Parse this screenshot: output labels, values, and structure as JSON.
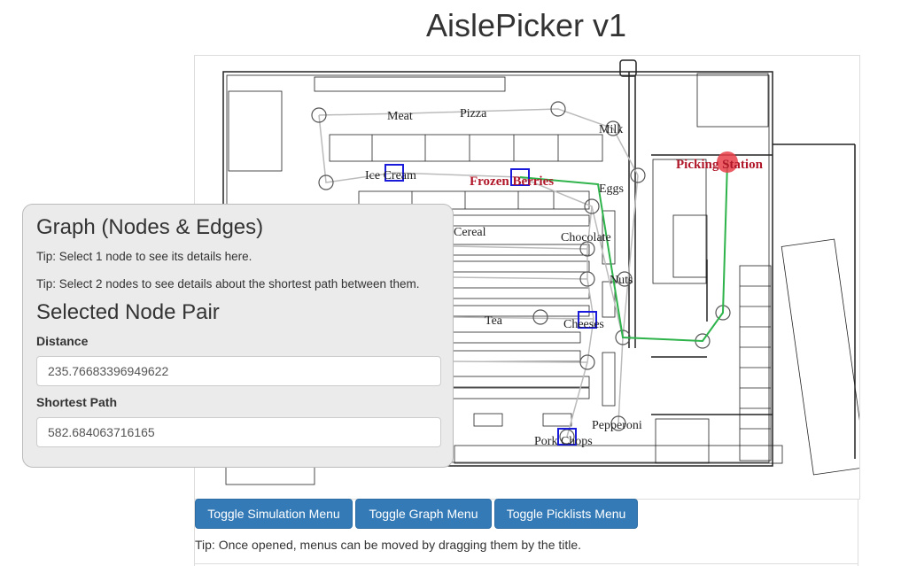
{
  "app": {
    "title": "AislePicker v1"
  },
  "map": {
    "labels": {
      "meat": "Meat",
      "pizza": "Pizza",
      "milk": "Milk",
      "ice_cream": "Ice Cream",
      "frozen_berries": "Frozen Berries",
      "picking_station": "Picking Station",
      "eggs": "Eggs",
      "cereal": "Cereal",
      "chocolate": "Chocolate",
      "nuts": "Nuts",
      "tea": "Tea",
      "cheeses": "Cheeses",
      "pepperoni": "Pepperoni",
      "pork_chops": "Pork Chops"
    },
    "colors": {
      "path": "#2db34a",
      "station": "#e8404a",
      "selected": "#1a1adb",
      "edge": "#bbbbbb"
    }
  },
  "panel": {
    "heading": "Graph (Nodes & Edges)",
    "tip1": "Tip: Select 1 node to see its details here.",
    "tip2": "Tip: Select 2 nodes to see details about the shortest path between them.",
    "pair_heading": "Selected Node Pair",
    "distance_label": "Distance",
    "distance_value": "235.76683396949622",
    "path_label": "Shortest Path",
    "path_value": "582.684063716165"
  },
  "buttons": {
    "simulation": "Toggle Simulation Menu",
    "graph": "Toggle Graph Menu",
    "picklists": "Toggle Picklists Menu"
  },
  "footer": {
    "tip": "Tip: Once opened, menus can be moved by dragging them by the title."
  }
}
